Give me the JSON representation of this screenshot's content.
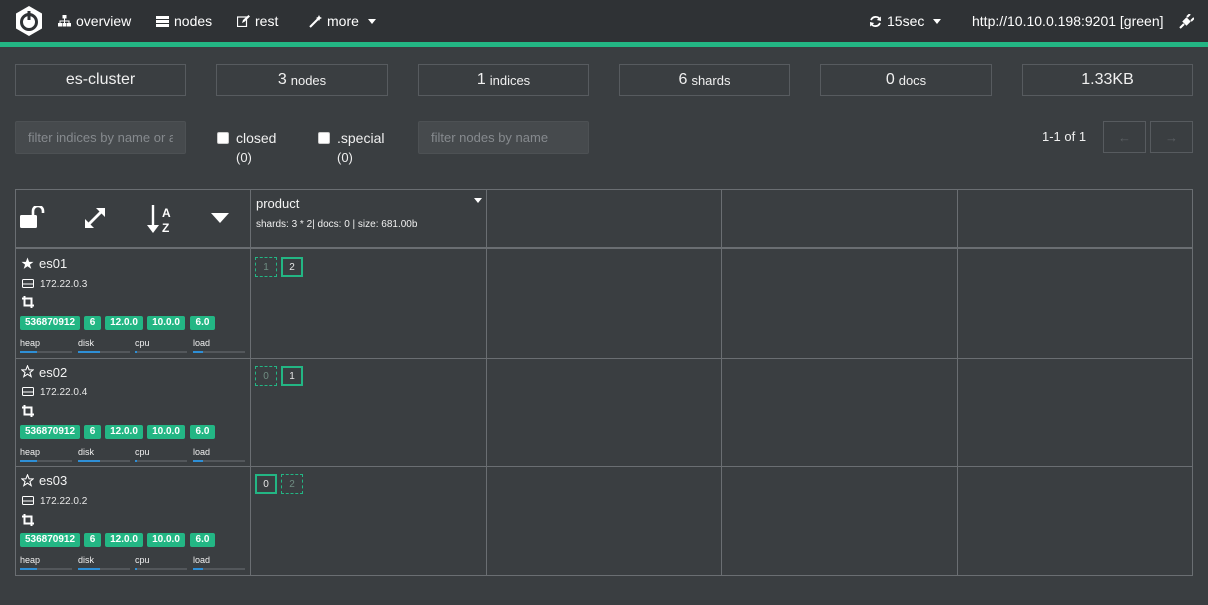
{
  "nav": {
    "overview": "overview",
    "nodes": "nodes",
    "rest": "rest",
    "more": "more",
    "refresh": "15sec",
    "cluster_url": "http://10.10.0.198:9201 [green]"
  },
  "stats": {
    "cluster_name": "es-cluster",
    "nodes_num": "3",
    "nodes_unit": "nodes",
    "indices_num": "1",
    "indices_unit": "indices",
    "shards_num": "6",
    "shards_unit": "shards",
    "docs_num": "0",
    "docs_unit": "docs",
    "size": "1.33KB"
  },
  "filters": {
    "indices_placeholder": "filter indices by name or a",
    "closed_label": "closed",
    "closed_count": "(0)",
    "special_label": ".special",
    "special_count": "(0)",
    "nodes_placeholder": "filter nodes by name"
  },
  "pager": {
    "text": "1-1 of 1",
    "prev": "←",
    "next": "→"
  },
  "index": {
    "name": "product",
    "meta": "shards: 3 * 2| docs: 0 | size: 681.00b"
  },
  "nodes": [
    {
      "name": "es01",
      "ip": "172.22.0.3",
      "badges": [
        "536870912",
        "6",
        "12.0.0",
        "10.0.0",
        "6.0"
      ],
      "metrics": [
        "heap",
        "disk",
        "cpu",
        "load"
      ],
      "shards": [
        "1",
        "2"
      ]
    },
    {
      "name": "es02",
      "ip": "172.22.0.4",
      "badges": [
        "536870912",
        "6",
        "12.0.0",
        "10.0.0",
        "6.0"
      ],
      "metrics": [
        "heap",
        "disk",
        "cpu",
        "load"
      ],
      "shards": [
        "0",
        "1"
      ]
    },
    {
      "name": "es03",
      "ip": "172.22.0.2",
      "badges": [
        "536870912",
        "6",
        "12.0.0",
        "10.0.0",
        "6.0"
      ],
      "metrics": [
        "heap",
        "disk",
        "cpu",
        "load"
      ],
      "shards": [
        "0",
        "2"
      ]
    }
  ],
  "colors": {
    "accent": "#23b684",
    "metric_bar": "#2e8fd6",
    "background": "#3a3e41",
    "navbar": "#2f3235"
  }
}
